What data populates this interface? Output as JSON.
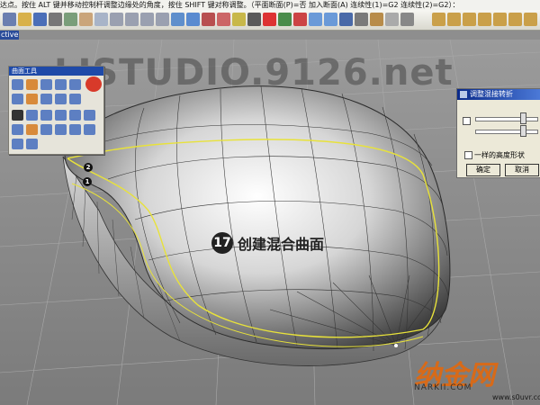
{
  "statusbar": {
    "text": "达点。按住 ALT 键并移动控制杆调整边缘处的角度，按住 SHIFT 键对称调整。（平面断面(P)=否  加入断面(A)  连续性(1)=G2  连续性(2)=G2）："
  },
  "viewport": {
    "tab_label": "ctive"
  },
  "tool_panel": {
    "title": "曲面工具"
  },
  "dialog": {
    "title": "调整混接转折",
    "checkbox_label": "一样的高度形状",
    "ok_label": "确定",
    "cancel_label": "取消"
  },
  "annotation": {
    "step_number": "17",
    "text": "创建混合曲面"
  },
  "markers": {
    "one": "1",
    "two": "2"
  },
  "watermark": {
    "text": "LISTUDIO.9126.net"
  },
  "logo": {
    "cn": "纳金网",
    "en": "NARKII.COM"
  },
  "site2": {
    "text": "www.s0uvr.com"
  },
  "colors": {
    "toolbar_bg": "#e4e3da",
    "title_blue": "#1f4aa8",
    "curve_yellow": "#e8e23a",
    "logo_orange": "#d86a18"
  }
}
